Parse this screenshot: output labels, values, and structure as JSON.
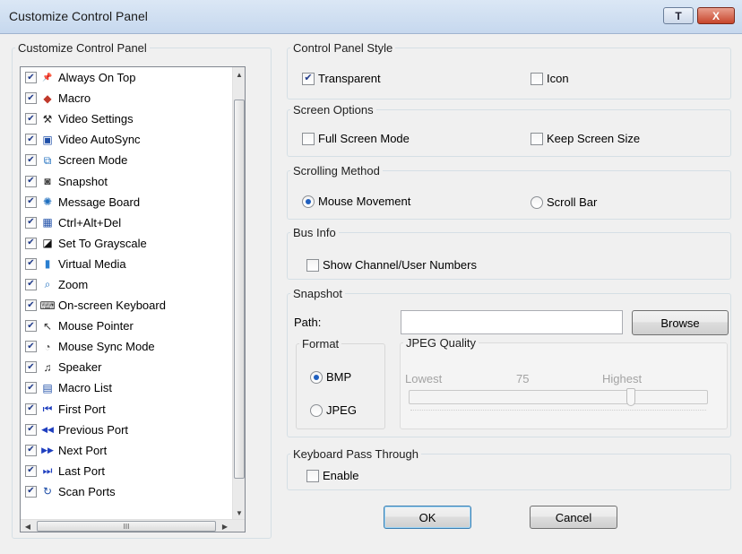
{
  "window": {
    "title": "Customize Control Panel",
    "help_button": "T",
    "close_button": "X"
  },
  "left_panel": {
    "legend": "Customize Control Panel",
    "items": [
      {
        "label": "Always On Top",
        "checked": true,
        "icon": "pin-icon"
      },
      {
        "label": "Macro",
        "checked": true,
        "icon": "macro-icon"
      },
      {
        "label": "Video Settings",
        "checked": true,
        "icon": "hammer-icon"
      },
      {
        "label": "Video AutoSync",
        "checked": true,
        "icon": "autosync-icon"
      },
      {
        "label": "Screen Mode",
        "checked": true,
        "icon": "screen-mode-icon"
      },
      {
        "label": "Snapshot",
        "checked": true,
        "icon": "camera-icon"
      },
      {
        "label": "Message Board",
        "checked": true,
        "icon": "message-board-icon"
      },
      {
        "label": "Ctrl+Alt+Del",
        "checked": true,
        "icon": "ctrl-alt-del-icon"
      },
      {
        "label": "Set To Grayscale",
        "checked": true,
        "icon": "grayscale-icon"
      },
      {
        "label": "Virtual Media",
        "checked": true,
        "icon": "usb-drive-icon"
      },
      {
        "label": "Zoom",
        "checked": true,
        "icon": "magnifier-icon"
      },
      {
        "label": "On-screen Keyboard",
        "checked": true,
        "icon": "keyboard-icon"
      },
      {
        "label": "Mouse Pointer",
        "checked": true,
        "icon": "pointer-icon"
      },
      {
        "label": "Mouse Sync Mode",
        "checked": true,
        "icon": "mouse-icon"
      },
      {
        "label": "Speaker",
        "checked": true,
        "icon": "speaker-icon"
      },
      {
        "label": "Macro List",
        "checked": true,
        "icon": "macro-list-icon"
      },
      {
        "label": "First Port",
        "checked": true,
        "icon": "first-port-icon"
      },
      {
        "label": "Previous Port",
        "checked": true,
        "icon": "previous-port-icon"
      },
      {
        "label": "Next Port",
        "checked": true,
        "icon": "next-port-icon"
      },
      {
        "label": "Last Port",
        "checked": true,
        "icon": "last-port-icon"
      },
      {
        "label": "Scan Ports",
        "checked": true,
        "icon": "scan-ports-icon"
      }
    ],
    "hscroll_thumb": "III"
  },
  "control_panel_style": {
    "legend": "Control Panel Style",
    "transparent_label": "Transparent",
    "transparent_checked": true,
    "icon_label": "Icon",
    "icon_checked": false
  },
  "screen_options": {
    "legend": "Screen Options",
    "full_screen_label": "Full Screen Mode",
    "keep_size_label": "Keep Screen Size"
  },
  "scrolling_method": {
    "legend": "Scrolling Method",
    "mouse_movement_label": "Mouse Movement",
    "scroll_bar_label": "Scroll Bar",
    "selected": "Mouse Movement"
  },
  "bus_info": {
    "legend": "Bus Info",
    "show_numbers_label": "Show Channel/User Numbers"
  },
  "snapshot": {
    "legend": "Snapshot",
    "path_label": "Path:",
    "path_value": "",
    "browse_label": "Browse",
    "format_legend": "Format",
    "bmp_label": "BMP",
    "jpeg_label": "JPEG",
    "selected_format": "BMP",
    "jpeg_quality": {
      "legend": "JPEG Quality",
      "lowest_label": "Lowest",
      "value_label": "75",
      "highest_label": "Highest",
      "value_fraction": 0.75
    }
  },
  "keyboard_pass_through": {
    "legend": "Keyboard Pass Through",
    "enable_label": "Enable"
  },
  "footer": {
    "ok_label": "OK",
    "cancel_label": "Cancel"
  }
}
